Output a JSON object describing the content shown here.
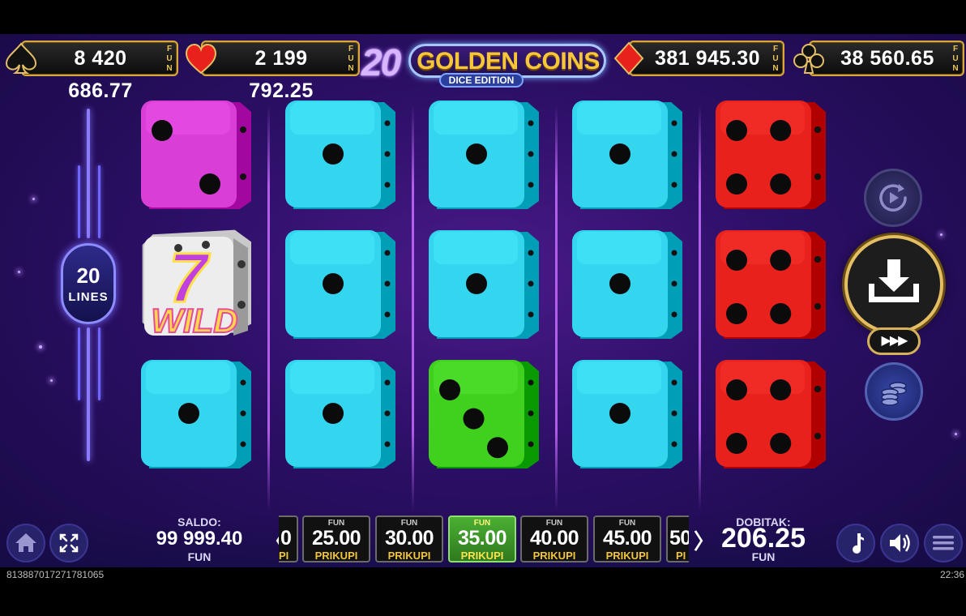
{
  "jackpots": [
    {
      "suit": "spade",
      "value": "8 420 686.77",
      "currency": "FUN",
      "icon": "spade-icon"
    },
    {
      "suit": "heart",
      "value": "2 199 792.25",
      "currency": "FUN",
      "icon": "heart-icon"
    },
    {
      "suit": "diamond",
      "value": "381 945.30",
      "currency": "FUN",
      "icon": "diamond-icon"
    },
    {
      "suit": "club",
      "value": "38 560.65",
      "currency": "FUN",
      "icon": "club-icon"
    }
  ],
  "logo": {
    "number": "20",
    "title": "GOLDEN COINS",
    "subtitle": "DICE EDITION"
  },
  "lines": {
    "count": "20",
    "label": "LINES"
  },
  "reels": [
    [
      {
        "color": "#d93fd6",
        "pips": 2
      },
      {
        "symbol": "wild",
        "text7": "7",
        "text": "WILD"
      },
      {
        "color": "#33d6ee",
        "pips": 1
      }
    ],
    [
      {
        "color": "#33d6ee",
        "pips": 1
      },
      {
        "color": "#33d6ee",
        "pips": 1
      },
      {
        "color": "#33d6ee",
        "pips": 1
      }
    ],
    [
      {
        "color": "#33d6ee",
        "pips": 1
      },
      {
        "color": "#33d6ee",
        "pips": 1
      },
      {
        "color": "#3fd11e",
        "pips": 3
      }
    ],
    [
      {
        "color": "#33d6ee",
        "pips": 1
      },
      {
        "color": "#33d6ee",
        "pips": 1
      },
      {
        "color": "#33d6ee",
        "pips": 1
      }
    ],
    [
      {
        "color": "#e8211c",
        "pips": 4
      },
      {
        "color": "#e8211c",
        "pips": 4
      },
      {
        "color": "#e8211c",
        "pips": 4
      }
    ]
  ],
  "controls": {
    "autoplay_icon": "autoplay-icon",
    "spin_icon": "download-arrow-icon",
    "turbo": "▶▶▶",
    "coins_icon": "coin-stack-icon"
  },
  "balance": {
    "label": "SALDO:",
    "value": "99 999.40",
    "currency": "FUN"
  },
  "bets": {
    "partial_left": {
      "value": "0",
      "label": "PI"
    },
    "items": [
      {
        "currency": "FUN",
        "value": "25.00",
        "label": "PRIKUPI",
        "selected": false
      },
      {
        "currency": "FUN",
        "value": "30.00",
        "label": "PRIKUPI",
        "selected": false
      },
      {
        "currency": "FUN",
        "value": "35.00",
        "label": "PRIKUPI",
        "selected": true
      },
      {
        "currency": "FUN",
        "value": "40.00",
        "label": "PRIKUPI",
        "selected": false
      },
      {
        "currency": "FUN",
        "value": "45.00",
        "label": "PRIKUPI",
        "selected": false
      }
    ],
    "partial_right": {
      "value": "50",
      "label": "PI"
    },
    "prev_arrow": "〈",
    "next_arrow": "〉"
  },
  "win": {
    "label": "DOBITAK:",
    "value": "206.25",
    "currency": "FUN"
  },
  "footer": {
    "session_id": "813887017271781065",
    "clock": "22:36"
  },
  "colors": {
    "accent_gold": "#e3be64",
    "bg": "#2c0f66",
    "selected_bet": "#4ab033"
  }
}
